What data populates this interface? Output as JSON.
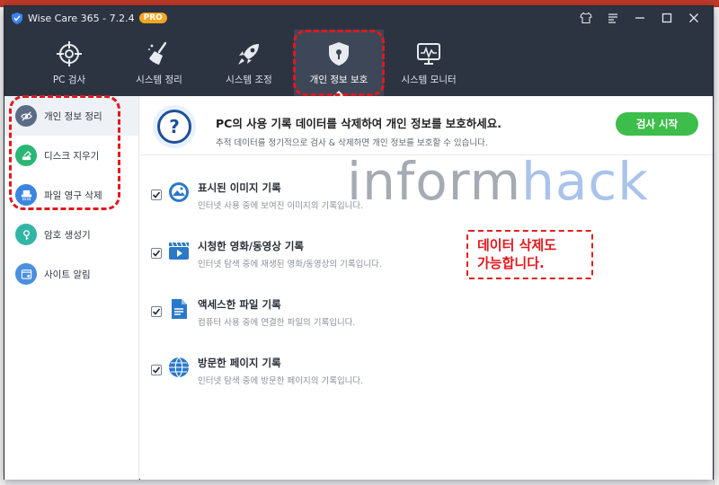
{
  "app": {
    "title": "Wise Care 365 - 7.2.4",
    "badge": "PRO",
    "icon": "wisecare-shield-icon"
  },
  "window_controls": {
    "icons": [
      "shirt-skin-icon",
      "menu-icon",
      "minimize-icon",
      "maximize-icon",
      "close-icon"
    ]
  },
  "nav": {
    "tabs": [
      {
        "label": "PC 검사",
        "icon": "crosshair-icon"
      },
      {
        "label": "시스템 정리",
        "icon": "broom-icon"
      },
      {
        "label": "시스템 조정",
        "icon": "rocket-icon"
      },
      {
        "label": "개인 정보 보호",
        "icon": "shield-lock-icon",
        "active": true
      },
      {
        "label": "시스템 모니터",
        "icon": "monitor-icon"
      }
    ]
  },
  "sidebar": {
    "items": [
      {
        "label": "개인 정보 정리",
        "icon": "eye-slash-icon",
        "color": "#5b6b86",
        "active": true
      },
      {
        "label": "디스크 지우기",
        "icon": "disk-eraser-icon",
        "color": "#2bb673"
      },
      {
        "label": "파일 영구 삭제",
        "icon": "shredder-icon",
        "color": "#3a86e0"
      },
      {
        "label": "암호 생성기",
        "icon": "key-icon",
        "color": "#33b5a6"
      },
      {
        "label": "사이트 알림",
        "icon": "site-alert-icon",
        "color": "#4a8fe0"
      }
    ]
  },
  "header": {
    "title": "PC의 사용 기록 데이터를 삭제하여 개인 정보를 보호하세요.",
    "subtitle": "추적 데이터를 정기적으로 검사 & 삭제하면 개인 정보를 보호할 수 있습니다.",
    "scan_button": "검사 시작",
    "icon": "question-icon"
  },
  "items": [
    {
      "title": "표시된 이미지 기록",
      "desc": "인터넷 사용 중에 보여진 이미지의 기록입니다.",
      "icon": "image-icon",
      "checked": true
    },
    {
      "title": "시청한 영화/동영상 기록",
      "desc": "인터넷 탐색 중에 재생된 영화/동영상의 기록입니다.",
      "icon": "video-icon",
      "checked": true
    },
    {
      "title": "액세스한 파일 기록",
      "desc": "컴퓨터 사용 중에 연결한 파일의 기록입니다.",
      "icon": "file-icon",
      "checked": true
    },
    {
      "title": "방문한 페이지 기록",
      "desc": "인터넷 탐색 중에 방문한 페이지의 기록입니다.",
      "icon": "globe-icon",
      "checked": true
    }
  ],
  "watermark": {
    "part1": "inform",
    "part2": "hack"
  },
  "callout": {
    "line1": "데이터 삭제도",
    "line2": "가능합니다."
  },
  "colors": {
    "accent_green": "#3dbd4a",
    "dark_bar": "#2c3442",
    "annotation_red": "#e0191e",
    "badge_orange": "#f5a623"
  }
}
